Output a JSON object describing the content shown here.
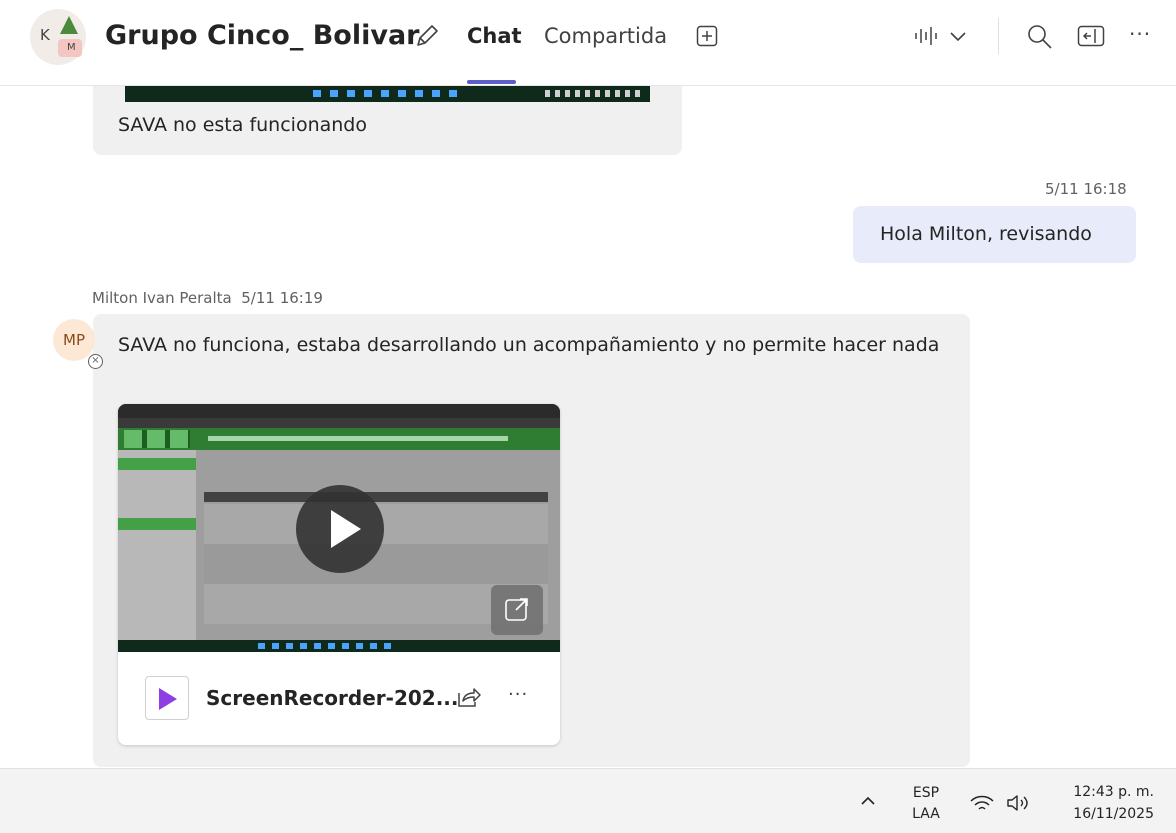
{
  "header": {
    "avatar_initials": [
      "K",
      "M"
    ],
    "title": "Grupo Cinco_ Bolivar",
    "tabs": [
      {
        "label": "Chat",
        "active": true
      },
      {
        "label": "Compartida",
        "active": false
      }
    ],
    "icons": [
      "edit-name-icon",
      "add-tab-icon",
      "call-audio-icon",
      "chevron-down-icon",
      "search-icon",
      "popout-icon",
      "more-options-icon"
    ],
    "more_label": "···",
    "accent_color": "#5b5fc7"
  },
  "messages": {
    "previous": {
      "text": "SAVA no esta funcionando"
    },
    "own": {
      "timestamp": "5/11 16:18",
      "text": "Hola Milton, revisando",
      "bubble_color": "#e8ebfa"
    },
    "incoming": {
      "sender": "Milton Ivan Peralta",
      "timestamp": "5/11 16:19",
      "avatar_initials": "MP",
      "text": "SAVA no funciona, estaba desarrollando un acompañamiento y no permite hacer nada",
      "attachment": {
        "file_name": "ScreenRecorder-202...",
        "icons": [
          "video-file-icon",
          "play-icon",
          "open-external-icon",
          "share-icon",
          "more-options-icon"
        ],
        "more_label": "···",
        "file_icon_color": "#8e3fe3"
      }
    }
  },
  "system_tray": {
    "lang_line1": "ESP",
    "lang_line2": "LAA",
    "time": "12:43 p. m.",
    "date": "16/11/2025",
    "icons": [
      "chevron-up-icon",
      "wifi-icon",
      "volume-icon"
    ]
  }
}
